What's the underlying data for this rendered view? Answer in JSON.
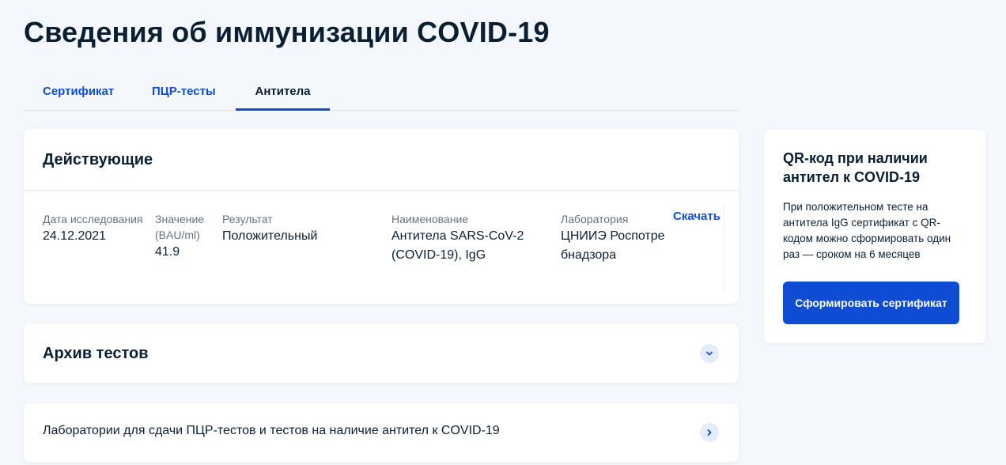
{
  "page": {
    "title": "Сведения об иммунизации COVID-19"
  },
  "tabs": [
    {
      "label": "Сертификат",
      "active": false
    },
    {
      "label": "ПЦР-тесты",
      "active": false
    },
    {
      "label": "Антитела",
      "active": true
    }
  ],
  "active_section": {
    "title": "Действующие",
    "columns": {
      "date": {
        "label": "Дата исследования",
        "value": "24.12.2021"
      },
      "value": {
        "label": "Значение (BAU/ml)",
        "value": "41.9"
      },
      "result": {
        "label": "Результат",
        "value": "Положительный"
      },
      "name": {
        "label": "Наименование",
        "value": "Антитела SARS-CoV-2 (COVID-19), IgG"
      },
      "laboratory": {
        "label": "Лаборатория",
        "value": "ЦНИИЭ Роспотребнадзора"
      }
    },
    "download_label": "Скачать"
  },
  "archive": {
    "title": "Архив тестов",
    "icon": "chevron-down-icon"
  },
  "labs_link": {
    "label": "Лаборатории для сдачи ПЦР-тестов и тестов на наличие антител к COVID-19",
    "icon": "chevron-right-icon"
  },
  "qr_card": {
    "title": "QR-код при наличии антител к COVID-19",
    "description": "При положительном тесте на антитела IgG сертификат с QR-кодом можно сформировать один раз — сроком на 6 месяцев",
    "button_label": "Сформировать сертификат"
  },
  "colors": {
    "accent": "#0d4cd3",
    "text": "#0b1f33",
    "muted": "#66727f",
    "background": "#f4f7fc"
  }
}
